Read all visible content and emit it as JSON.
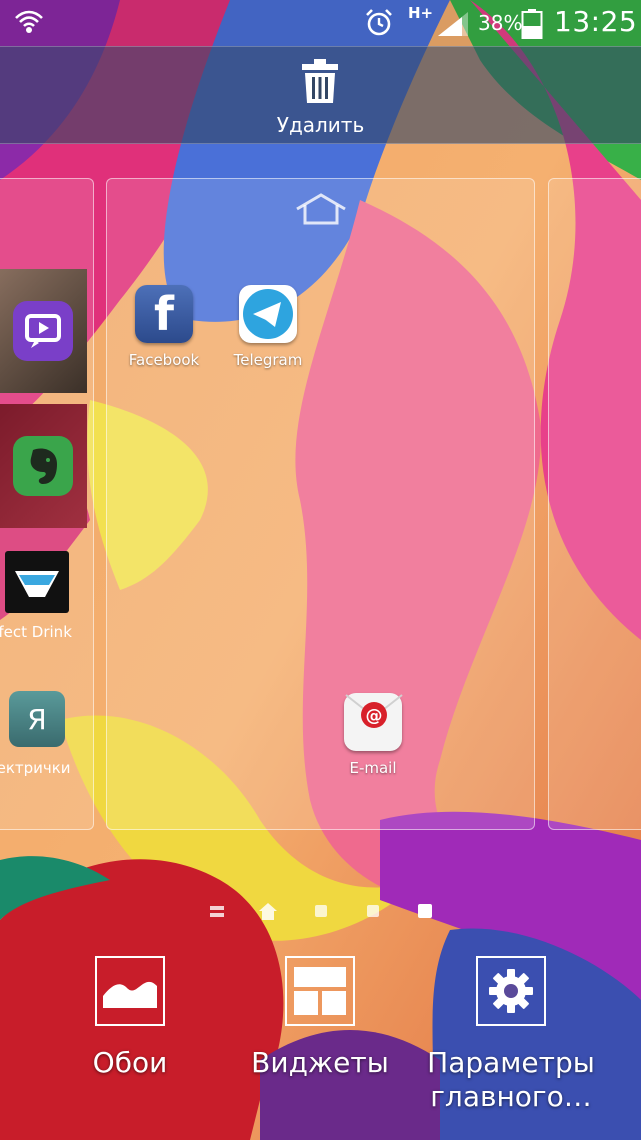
{
  "status": {
    "network": "H+",
    "battery_percent": "38%",
    "time": "13:25"
  },
  "delete_bar": {
    "label": "Удалить"
  },
  "main_page": {
    "apps": [
      {
        "label": "Facebook",
        "icon": "facebook-icon"
      },
      {
        "label": "Telegram",
        "icon": "telegram-icon"
      },
      {
        "label": "E-mail",
        "icon": "email-icon"
      }
    ]
  },
  "left_page": {
    "apps": [
      {
        "label": "erfect Drink",
        "icon": "perfect-drink-icon"
      },
      {
        "label": "лектрички",
        "icon": "train-icon"
      }
    ]
  },
  "page_indicator": {
    "page_count": 4,
    "active_index": 3
  },
  "options": [
    {
      "label": "Обои",
      "icon": "wallpaper-icon"
    },
    {
      "label": "Виджеты",
      "icon": "widgets-icon"
    },
    {
      "label": "Параметры главного…",
      "icon": "gear-icon"
    }
  ],
  "colors": {
    "accent_red": "#cc1f2a",
    "delete_bar": "#324664"
  }
}
